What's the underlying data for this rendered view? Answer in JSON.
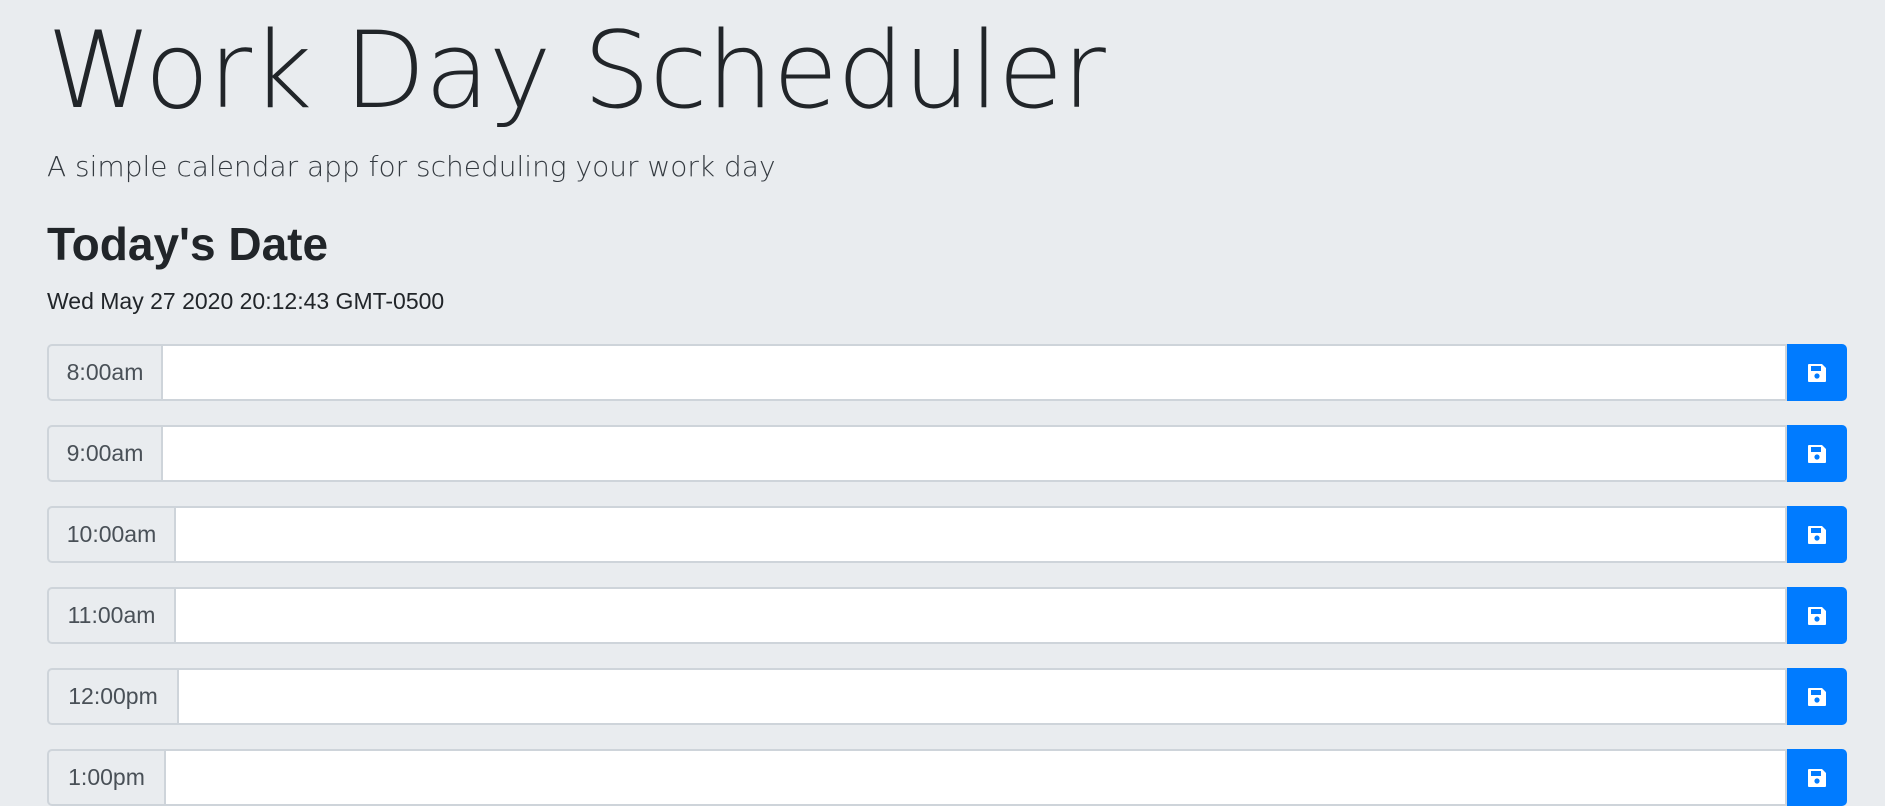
{
  "header": {
    "title": "Work Day Scheduler",
    "subtitle": "A simple calendar app for scheduling your work day"
  },
  "today": {
    "heading": "Today's Date",
    "value": "Wed May 27 2020 20:12:43 GMT-0500"
  },
  "schedule": {
    "rows": [
      {
        "hour": "8:00am",
        "task": "",
        "save_icon": "save-icon"
      },
      {
        "hour": "9:00am",
        "task": "",
        "save_icon": "save-icon"
      },
      {
        "hour": "10:00am",
        "task": "",
        "save_icon": "save-icon"
      },
      {
        "hour": "11:00am",
        "task": "",
        "save_icon": "save-icon"
      },
      {
        "hour": "12:00pm",
        "task": "",
        "save_icon": "save-icon"
      },
      {
        "hour": "1:00pm",
        "task": "",
        "save_icon": "save-icon"
      }
    ]
  },
  "colors": {
    "background": "#e9ecef",
    "accent": "#007bff",
    "border": "#ced4da",
    "text": "#212529"
  }
}
